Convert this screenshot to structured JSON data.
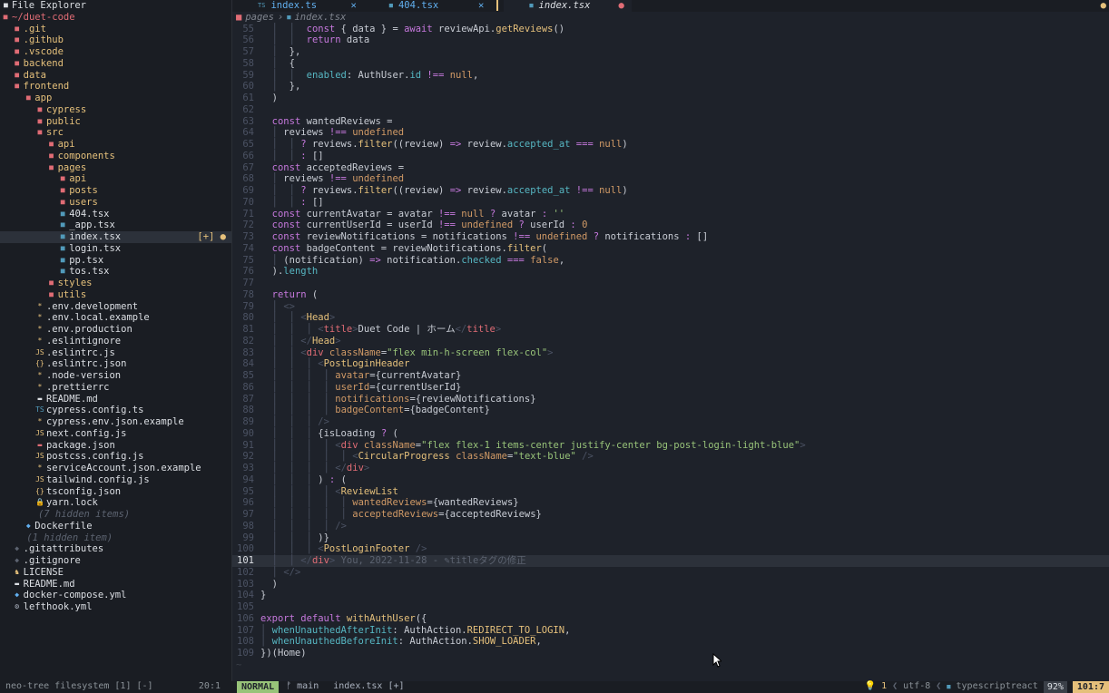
{
  "explorer": {
    "title": "File Explorer",
    "root": "~/duet-code",
    "items": [
      {
        "indent": "  ",
        "icon": "folder-icon",
        "ic": "dir",
        "glyph": "■",
        "name": ".git",
        "type": "dir"
      },
      {
        "indent": "  ",
        "icon": "folder-icon",
        "ic": "dir",
        "glyph": "■",
        "name": ".github",
        "type": "dir"
      },
      {
        "indent": "  ",
        "icon": "folder-icon",
        "ic": "dir",
        "glyph": "■",
        "name": ".vscode",
        "type": "dir"
      },
      {
        "indent": "  ",
        "icon": "folder-icon",
        "ic": "dir",
        "glyph": "■",
        "name": "backend",
        "type": "dir"
      },
      {
        "indent": "  ",
        "icon": "folder-icon",
        "ic": "dir",
        "glyph": "■",
        "name": "data",
        "type": "dir"
      },
      {
        "indent": "  ",
        "icon": "folder-open-icon",
        "ic": "dir",
        "glyph": "■",
        "name": "frontend",
        "type": "dir"
      },
      {
        "indent": "    ",
        "icon": "folder-open-icon",
        "ic": "dir",
        "glyph": "■",
        "name": "app",
        "type": "dir"
      },
      {
        "indent": "      ",
        "icon": "folder-icon",
        "ic": "dir",
        "glyph": "■",
        "name": "cypress",
        "type": "dir"
      },
      {
        "indent": "      ",
        "icon": "folder-icon",
        "ic": "dir",
        "glyph": "■",
        "name": "public",
        "type": "dir"
      },
      {
        "indent": "      ",
        "icon": "folder-open-icon",
        "ic": "dir",
        "glyph": "■",
        "name": "src",
        "type": "dir"
      },
      {
        "indent": "        ",
        "icon": "folder-icon",
        "ic": "dir",
        "glyph": "■",
        "name": "api",
        "type": "dir"
      },
      {
        "indent": "        ",
        "icon": "folder-icon",
        "ic": "dir",
        "glyph": "■",
        "name": "components",
        "type": "dir"
      },
      {
        "indent": "        ",
        "icon": "folder-open-icon",
        "ic": "dir",
        "glyph": "■",
        "name": "pages",
        "type": "dir"
      },
      {
        "indent": "          ",
        "icon": "folder-icon",
        "ic": "dir",
        "glyph": "■",
        "name": "api",
        "type": "dir"
      },
      {
        "indent": "          ",
        "icon": "folder-icon",
        "ic": "dir",
        "glyph": "■",
        "name": "posts",
        "type": "dir"
      },
      {
        "indent": "          ",
        "icon": "folder-icon",
        "ic": "dir",
        "glyph": "■",
        "name": "users",
        "type": "dir"
      },
      {
        "indent": "          ",
        "icon": "react-file-icon",
        "ic": "ts",
        "glyph": "■",
        "name": "404.tsx",
        "type": "file"
      },
      {
        "indent": "          ",
        "icon": "react-file-icon",
        "ic": "ts",
        "glyph": "■",
        "name": "_app.tsx",
        "type": "file"
      },
      {
        "indent": "          ",
        "icon": "react-file-icon",
        "ic": "ts",
        "glyph": "■",
        "name": "index.tsx",
        "type": "file",
        "active": true,
        "flag": "[+] ●"
      },
      {
        "indent": "          ",
        "icon": "react-file-icon",
        "ic": "ts",
        "glyph": "■",
        "name": "login.tsx",
        "type": "file"
      },
      {
        "indent": "          ",
        "icon": "react-file-icon",
        "ic": "ts",
        "glyph": "■",
        "name": "pp.tsx",
        "type": "file"
      },
      {
        "indent": "          ",
        "icon": "react-file-icon",
        "ic": "ts",
        "glyph": "■",
        "name": "tos.tsx",
        "type": "file"
      },
      {
        "indent": "        ",
        "icon": "folder-icon",
        "ic": "dir",
        "glyph": "■",
        "name": "styles",
        "type": "dir"
      },
      {
        "indent": "        ",
        "icon": "folder-icon",
        "ic": "dir",
        "glyph": "■",
        "name": "utils",
        "type": "dir"
      },
      {
        "indent": "      ",
        "icon": "config-file-icon",
        "ic": "star",
        "glyph": "*",
        "name": ".env.development",
        "type": "file"
      },
      {
        "indent": "      ",
        "icon": "config-file-icon",
        "ic": "star",
        "glyph": "*",
        "name": ".env.local.example",
        "type": "file"
      },
      {
        "indent": "      ",
        "icon": "config-file-icon",
        "ic": "star",
        "glyph": "*",
        "name": ".env.production",
        "type": "file"
      },
      {
        "indent": "      ",
        "icon": "config-file-icon",
        "ic": "star",
        "glyph": "*",
        "name": ".eslintignore",
        "type": "file"
      },
      {
        "indent": "      ",
        "icon": "js-file-icon",
        "ic": "js",
        "glyph": "JS",
        "name": ".eslintrc.js",
        "type": "file"
      },
      {
        "indent": "      ",
        "icon": "json-file-icon",
        "ic": "json",
        "glyph": "{}",
        "name": ".eslintrc.json",
        "type": "file"
      },
      {
        "indent": "      ",
        "icon": "config-file-icon",
        "ic": "star",
        "glyph": "*",
        "name": ".node-version",
        "type": "file"
      },
      {
        "indent": "      ",
        "icon": "config-file-icon",
        "ic": "star",
        "glyph": "*",
        "name": ".prettierrc",
        "type": "file"
      },
      {
        "indent": "      ",
        "icon": "markdown-file-icon",
        "ic": "md",
        "glyph": "▬",
        "name": "README.md",
        "type": "file"
      },
      {
        "indent": "      ",
        "icon": "ts-file-icon",
        "ic": "ts",
        "glyph": "TS",
        "name": "cypress.config.ts",
        "type": "file"
      },
      {
        "indent": "      ",
        "icon": "config-file-icon",
        "ic": "star",
        "glyph": "*",
        "name": "cypress.env.json.example",
        "type": "file"
      },
      {
        "indent": "      ",
        "icon": "js-file-icon",
        "ic": "js",
        "glyph": "JS",
        "name": "next.config.js",
        "type": "file"
      },
      {
        "indent": "      ",
        "icon": "npm-file-icon",
        "ic": "yml",
        "glyph": "▬",
        "name": "package.json",
        "type": "file"
      },
      {
        "indent": "      ",
        "icon": "js-file-icon",
        "ic": "js",
        "glyph": "JS",
        "name": "postcss.config.js",
        "type": "file"
      },
      {
        "indent": "      ",
        "icon": "config-file-icon",
        "ic": "star",
        "glyph": "*",
        "name": "serviceAccount.json.example",
        "type": "file"
      },
      {
        "indent": "      ",
        "icon": "js-file-icon",
        "ic": "js",
        "glyph": "JS",
        "name": "tailwind.config.js",
        "type": "file"
      },
      {
        "indent": "      ",
        "icon": "json-file-icon",
        "ic": "json",
        "glyph": "{}",
        "name": "tsconfig.json",
        "type": "file"
      },
      {
        "indent": "      ",
        "icon": "lock-icon",
        "ic": "lock",
        "glyph": "🔒",
        "name": "yarn.lock",
        "type": "file"
      },
      {
        "indent": "      ",
        "icon": "",
        "ic": "",
        "glyph": "",
        "name": "(7 hidden items)",
        "type": "hidden"
      },
      {
        "indent": "    ",
        "icon": "docker-icon",
        "ic": "docker",
        "glyph": "◆",
        "name": "Dockerfile",
        "type": "file"
      },
      {
        "indent": "    ",
        "icon": "",
        "ic": "",
        "glyph": "",
        "name": "(1 hidden item)",
        "type": "hidden"
      },
      {
        "indent": "  ",
        "icon": "git-icon",
        "ic": "git",
        "glyph": "◆",
        "name": ".gitattributes",
        "type": "file"
      },
      {
        "indent": "  ",
        "icon": "git-icon",
        "ic": "git",
        "glyph": "◆",
        "name": ".gitignore",
        "type": "file"
      },
      {
        "indent": "  ",
        "icon": "license-icon",
        "ic": "lic",
        "glyph": "♞",
        "name": "LICENSE",
        "type": "file"
      },
      {
        "indent": "  ",
        "icon": "markdown-file-icon",
        "ic": "md",
        "glyph": "▬",
        "name": "README.md",
        "type": "file"
      },
      {
        "indent": "  ",
        "icon": "docker-icon",
        "ic": "docker",
        "glyph": "◆",
        "name": "docker-compose.yml",
        "type": "file"
      },
      {
        "indent": "  ",
        "icon": "gear-icon",
        "ic": "gear",
        "glyph": "⚙",
        "name": "lefthook.yml",
        "type": "file"
      }
    ]
  },
  "tabs": [
    {
      "name": "index.ts",
      "close": "✕",
      "active": false
    },
    {
      "name": "404.tsx",
      "close": "✕",
      "active": false
    },
    {
      "name": "index.tsx",
      "close": "●",
      "active": true
    }
  ],
  "tabline_right": "●",
  "breadcrumb": {
    "folder": "pages",
    "sep": "›",
    "file": "index.tsx"
  },
  "code": [
    {
      "n": "55",
      "h": "  │  │  <span class='k'>const</span> { data } = <span class='k'>await</span> reviewApi.<span class='f'>getReviews</span>()"
    },
    {
      "n": "56",
      "h": "  │  │  <span class='k'>return</span> data"
    },
    {
      "n": "57",
      "h": "  │  },"
    },
    {
      "n": "58",
      "h": "  │  {"
    },
    {
      "n": "59",
      "h": "  │  │  <span class='p'>enabled</span>: AuthUser.<span class='p'>id</span> <span class='k'>!==</span> <span class='n'>null</span>,"
    },
    {
      "n": "60",
      "h": "  │  },"
    },
    {
      "n": "61",
      "h": "  )"
    },
    {
      "n": "62",
      "h": ""
    },
    {
      "n": "63",
      "h": "  <span class='k'>const</span> wantedReviews ="
    },
    {
      "n": "64",
      "h": "  │ reviews <span class='k'>!==</span> <span class='n'>undefined</span>"
    },
    {
      "n": "65",
      "h": "  │  │ <span class='k'>?</span> reviews.<span class='f'>filter</span>((review) <span class='k'>=&gt;</span> review.<span class='p'>accepted_at</span> <span class='k'>===</span> <span class='n'>null</span>)"
    },
    {
      "n": "66",
      "h": "  │  │ <span class='k'>:</span> []"
    },
    {
      "n": "67",
      "h": "  <span class='k'>const</span> acceptedReviews ="
    },
    {
      "n": "68",
      "h": "  │ reviews <span class='k'>!==</span> <span class='n'>undefined</span>"
    },
    {
      "n": "69",
      "h": "  │  │ <span class='k'>?</span> reviews.<span class='f'>filter</span>((review) <span class='k'>=&gt;</span> review.<span class='p'>accepted_at</span> <span class='k'>!==</span> <span class='n'>null</span>)"
    },
    {
      "n": "70",
      "h": "  │  │ <span class='k'>:</span> []"
    },
    {
      "n": "71",
      "h": "  <span class='k'>const</span> currentAvatar = avatar <span class='k'>!==</span> <span class='n'>null</span> <span class='k'>?</span> avatar <span class='k'>:</span> <span class='s'>''</span>"
    },
    {
      "n": "72",
      "h": "  <span class='k'>const</span> currentUserId = userId <span class='k'>!==</span> <span class='n'>undefined</span> <span class='k'>?</span> userId <span class='k'>:</span> <span class='n'>0</span>"
    },
    {
      "n": "73",
      "h": "  <span class='k'>const</span> reviewNotifications = notifications <span class='k'>!==</span> <span class='n'>undefined</span> <span class='k'>?</span> notifications <span class='k'>:</span> []"
    },
    {
      "n": "74",
      "h": "  <span class='k'>const</span> badgeContent = reviewNotifications.<span class='f'>filter</span>("
    },
    {
      "n": "75",
      "h": "  │ (notification) <span class='k'>=&gt;</span> notification.<span class='p'>checked</span> <span class='k'>===</span> <span class='n'>false</span>,"
    },
    {
      "n": "76",
      "h": "  ).<span class='p'>length</span>"
    },
    {
      "n": "77",
      "h": ""
    },
    {
      "n": "78",
      "h": "  <span class='k'>return</span> ("
    },
    {
      "n": "79",
      "h": "  │ <span class='g'>&lt;&gt;</span>"
    },
    {
      "n": "80",
      "h": "  │  │ <span class='g'>&lt;</span><span class='a'>Head</span><span class='g'>&gt;</span>"
    },
    {
      "n": "81",
      "h": "  │  │  │ <span class='g'>&lt;</span><span class='t'>title</span><span class='g'>&gt;</span>Duet Code | ホーム<span class='g'>&lt;/</span><span class='t'>title</span><span class='g'>&gt;</span>"
    },
    {
      "n": "82",
      "h": "  │  │ <span class='g'>&lt;/</span><span class='a'>Head</span><span class='g'>&gt;</span>"
    },
    {
      "n": "83",
      "h": "  │  │ <span class='g'>&lt;</span><span class='t'>div</span> <span class='n'>className</span>=<span class='s'>\"flex min-h-screen flex-col\"</span><span class='g'>&gt;</span>"
    },
    {
      "n": "84",
      "h": "  │  │  │ <span class='g'>&lt;</span><span class='a'>PostLoginHeader</span>"
    },
    {
      "n": "85",
      "h": "  │  │  │  │ <span class='n'>avatar</span>={currentAvatar}"
    },
    {
      "n": "86",
      "h": "  │  │  │  │ <span class='n'>userId</span>={currentUserId}"
    },
    {
      "n": "87",
      "h": "  │  │  │  │ <span class='n'>notifications</span>={reviewNotifications}"
    },
    {
      "n": "88",
      "h": "  │  │  │  │ <span class='n'>badgeContent</span>={badgeContent}"
    },
    {
      "n": "89",
      "h": "  │  │  │ <span class='g'>/&gt;</span>"
    },
    {
      "n": "90",
      "h": "  │  │  │ {isLoading <span class='k'>?</span> ("
    },
    {
      "n": "91",
      "h": "  │  │  │  │ <span class='g'>&lt;</span><span class='t'>div</span> <span class='n'>className</span>=<span class='s'>\"flex flex-1 items-center justify-center bg-post-login-light-blue\"</span><span class='g'>&gt;</span>"
    },
    {
      "n": "92",
      "h": "  │  │  │  │  │ <span class='g'>&lt;</span><span class='a'>CircularProgress</span> <span class='n'>className</span>=<span class='s'>\"text-blue\"</span> <span class='g'>/&gt;</span>"
    },
    {
      "n": "93",
      "h": "  │  │  │  │ <span class='g'>&lt;/</span><span class='t'>div</span><span class='g'>&gt;</span>"
    },
    {
      "n": "94",
      "h": "  │  │  │ ) <span class='k'>:</span> ("
    },
    {
      "n": "95",
      "h": "  │  │  │  │ <span class='g'>&lt;</span><span class='a'>ReviewList</span>"
    },
    {
      "n": "96",
      "h": "  │  │  │  │  │ <span class='n'>wantedReviews</span>={wantedReviews}"
    },
    {
      "n": "97",
      "h": "  │  │  │  │  │ <span class='n'>acceptedReviews</span>={acceptedReviews}"
    },
    {
      "n": "98",
      "h": "  │  │  │  │ <span class='g'>/&gt;</span>"
    },
    {
      "n": "99",
      "h": "  │  │  │ )}"
    },
    {
      "n": "100",
      "h": "  │  │  │ <span class='g'>&lt;</span><span class='a'>PostLoginFooter</span> <span class='g'>/&gt;</span>"
    },
    {
      "n": "101",
      "h": "  │  │ <span class='g'>&lt;/</span><span class='t'>div</span><span class='g'>&gt;</span> <span class='c'>You, 2022-11-28 - ✎titleタグの修正</span>",
      "cur": true
    },
    {
      "n": "102",
      "h": "  │ <span class='g'>&lt;/&gt;</span>"
    },
    {
      "n": "103",
      "h": "  )"
    },
    {
      "n": "104",
      "h": "}"
    },
    {
      "n": "105",
      "h": ""
    },
    {
      "n": "106",
      "h": "<span class='k'>export</span> <span class='k'>default</span> <span class='f'>withAuthUser</span>({"
    },
    {
      "n": "107",
      "h": "│ <span class='p'>whenUnauthedAfterInit</span>: AuthAction.<span class='f'>REDIRECT_TO_LOGIN</span>,"
    },
    {
      "n": "108",
      "h": "│ <span class='p'>whenUnauthedBeforeInit</span>: AuthAction.<span class='f'>SHOW_LOADER</span>,"
    },
    {
      "n": "109",
      "h": "})(Home)"
    }
  ],
  "tilde": "~",
  "status": {
    "tree_label": "neo-tree filesystem [1] [-]",
    "tree_pos": "20:1",
    "mode": "NORMAL",
    "branch": "ᚠ main",
    "file": "index.tsx [+]",
    "lsp": "💡 1",
    "encoding": "utf-8",
    "filetype": "typescriptreact",
    "percent": "92%",
    "position": "101:7"
  }
}
